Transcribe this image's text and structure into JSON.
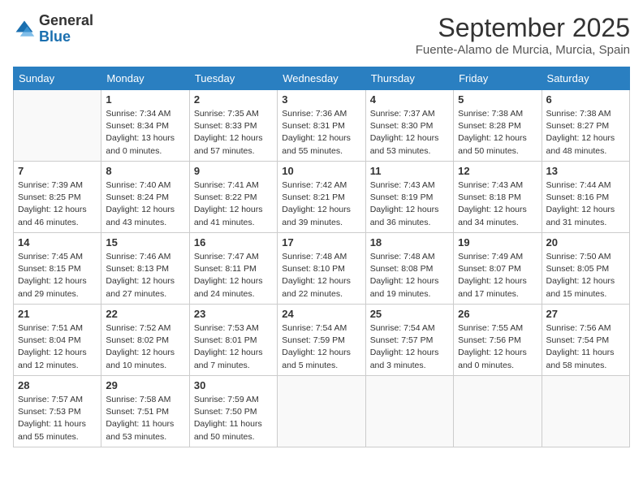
{
  "header": {
    "logo_general": "General",
    "logo_blue": "Blue",
    "month_title": "September 2025",
    "location": "Fuente-Alamo de Murcia, Murcia, Spain"
  },
  "days_of_week": [
    "Sunday",
    "Monday",
    "Tuesday",
    "Wednesday",
    "Thursday",
    "Friday",
    "Saturday"
  ],
  "weeks": [
    [
      {
        "day": "",
        "info": ""
      },
      {
        "day": "1",
        "info": "Sunrise: 7:34 AM\nSunset: 8:34 PM\nDaylight: 13 hours\nand 0 minutes."
      },
      {
        "day": "2",
        "info": "Sunrise: 7:35 AM\nSunset: 8:33 PM\nDaylight: 12 hours\nand 57 minutes."
      },
      {
        "day": "3",
        "info": "Sunrise: 7:36 AM\nSunset: 8:31 PM\nDaylight: 12 hours\nand 55 minutes."
      },
      {
        "day": "4",
        "info": "Sunrise: 7:37 AM\nSunset: 8:30 PM\nDaylight: 12 hours\nand 53 minutes."
      },
      {
        "day": "5",
        "info": "Sunrise: 7:38 AM\nSunset: 8:28 PM\nDaylight: 12 hours\nand 50 minutes."
      },
      {
        "day": "6",
        "info": "Sunrise: 7:38 AM\nSunset: 8:27 PM\nDaylight: 12 hours\nand 48 minutes."
      }
    ],
    [
      {
        "day": "7",
        "info": "Sunrise: 7:39 AM\nSunset: 8:25 PM\nDaylight: 12 hours\nand 46 minutes."
      },
      {
        "day": "8",
        "info": "Sunrise: 7:40 AM\nSunset: 8:24 PM\nDaylight: 12 hours\nand 43 minutes."
      },
      {
        "day": "9",
        "info": "Sunrise: 7:41 AM\nSunset: 8:22 PM\nDaylight: 12 hours\nand 41 minutes."
      },
      {
        "day": "10",
        "info": "Sunrise: 7:42 AM\nSunset: 8:21 PM\nDaylight: 12 hours\nand 39 minutes."
      },
      {
        "day": "11",
        "info": "Sunrise: 7:43 AM\nSunset: 8:19 PM\nDaylight: 12 hours\nand 36 minutes."
      },
      {
        "day": "12",
        "info": "Sunrise: 7:43 AM\nSunset: 8:18 PM\nDaylight: 12 hours\nand 34 minutes."
      },
      {
        "day": "13",
        "info": "Sunrise: 7:44 AM\nSunset: 8:16 PM\nDaylight: 12 hours\nand 31 minutes."
      }
    ],
    [
      {
        "day": "14",
        "info": "Sunrise: 7:45 AM\nSunset: 8:15 PM\nDaylight: 12 hours\nand 29 minutes."
      },
      {
        "day": "15",
        "info": "Sunrise: 7:46 AM\nSunset: 8:13 PM\nDaylight: 12 hours\nand 27 minutes."
      },
      {
        "day": "16",
        "info": "Sunrise: 7:47 AM\nSunset: 8:11 PM\nDaylight: 12 hours\nand 24 minutes."
      },
      {
        "day": "17",
        "info": "Sunrise: 7:48 AM\nSunset: 8:10 PM\nDaylight: 12 hours\nand 22 minutes."
      },
      {
        "day": "18",
        "info": "Sunrise: 7:48 AM\nSunset: 8:08 PM\nDaylight: 12 hours\nand 19 minutes."
      },
      {
        "day": "19",
        "info": "Sunrise: 7:49 AM\nSunset: 8:07 PM\nDaylight: 12 hours\nand 17 minutes."
      },
      {
        "day": "20",
        "info": "Sunrise: 7:50 AM\nSunset: 8:05 PM\nDaylight: 12 hours\nand 15 minutes."
      }
    ],
    [
      {
        "day": "21",
        "info": "Sunrise: 7:51 AM\nSunset: 8:04 PM\nDaylight: 12 hours\nand 12 minutes."
      },
      {
        "day": "22",
        "info": "Sunrise: 7:52 AM\nSunset: 8:02 PM\nDaylight: 12 hours\nand 10 minutes."
      },
      {
        "day": "23",
        "info": "Sunrise: 7:53 AM\nSunset: 8:01 PM\nDaylight: 12 hours\nand 7 minutes."
      },
      {
        "day": "24",
        "info": "Sunrise: 7:54 AM\nSunset: 7:59 PM\nDaylight: 12 hours\nand 5 minutes."
      },
      {
        "day": "25",
        "info": "Sunrise: 7:54 AM\nSunset: 7:57 PM\nDaylight: 12 hours\nand 3 minutes."
      },
      {
        "day": "26",
        "info": "Sunrise: 7:55 AM\nSunset: 7:56 PM\nDaylight: 12 hours\nand 0 minutes."
      },
      {
        "day": "27",
        "info": "Sunrise: 7:56 AM\nSunset: 7:54 PM\nDaylight: 11 hours\nand 58 minutes."
      }
    ],
    [
      {
        "day": "28",
        "info": "Sunrise: 7:57 AM\nSunset: 7:53 PM\nDaylight: 11 hours\nand 55 minutes."
      },
      {
        "day": "29",
        "info": "Sunrise: 7:58 AM\nSunset: 7:51 PM\nDaylight: 11 hours\nand 53 minutes."
      },
      {
        "day": "30",
        "info": "Sunrise: 7:59 AM\nSunset: 7:50 PM\nDaylight: 11 hours\nand 50 minutes."
      },
      {
        "day": "",
        "info": ""
      },
      {
        "day": "",
        "info": ""
      },
      {
        "day": "",
        "info": ""
      },
      {
        "day": "",
        "info": ""
      }
    ]
  ]
}
